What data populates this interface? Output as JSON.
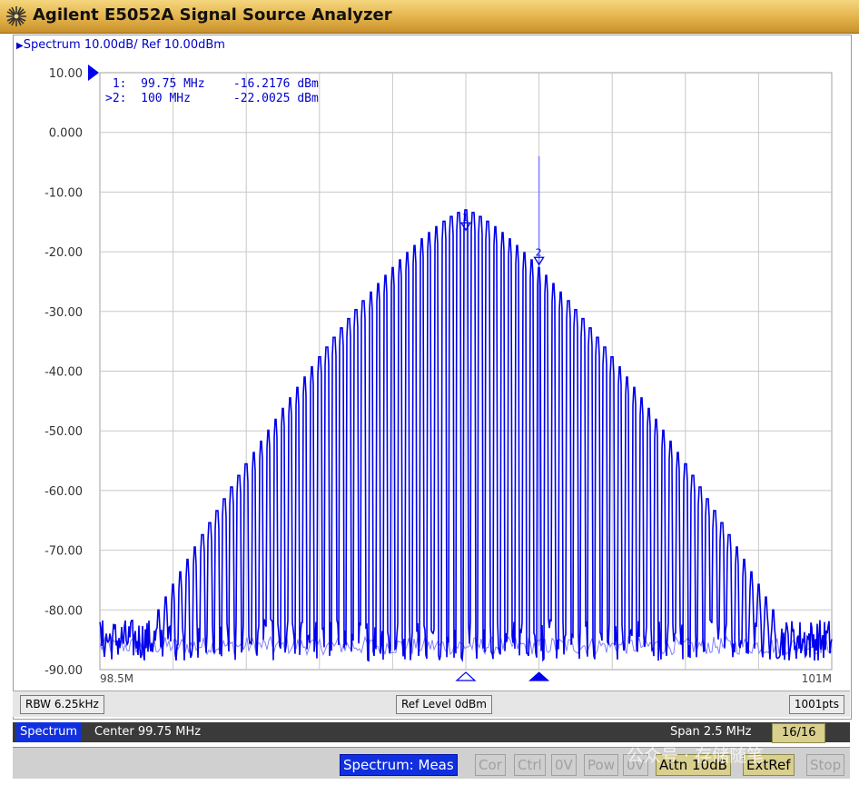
{
  "window": {
    "title": "Agilent E5052A Signal Source Analyzer",
    "logo_icon": "agilent-spark-icon"
  },
  "trace_header": {
    "arrow_icon": "trace-indicator-icon",
    "text": "Spectrum 10.00dB/ Ref 10.00dBm"
  },
  "markers": {
    "line1": " 1:  99.75 MHz    -16.2176 dBm",
    "line2": ">2:  100 MHz      -22.0025 dBm",
    "marker1_label": "1",
    "marker2_label": "2"
  },
  "x_axis": {
    "start_label": "98.5M",
    "stop_label": "101M"
  },
  "chart_data": {
    "type": "line",
    "ylim": [
      -90,
      10
    ],
    "yticks": [
      "10.00",
      "0.000",
      "-10.00",
      "-20.00",
      "-30.00",
      "-40.00",
      "-50.00",
      "-60.00",
      "-70.00",
      "-80.00",
      "-90.00"
    ],
    "xlim": [
      98.5,
      101.0
    ],
    "x_unit": "MHz",
    "grid": true,
    "spur_spacing_mhz": 0.025,
    "envelope_center_mhz": 99.75,
    "envelope_peak_dbm": -13,
    "envelope_edge_dbm": -80,
    "noise_floor_dbm": -86,
    "carrier": {
      "x": 100.0,
      "y": -4
    },
    "markers": [
      {
        "id": "1",
        "x": 99.75,
        "y": -16.2176
      },
      {
        "id": "2",
        "x": 100.0,
        "y": -22.0025
      }
    ],
    "series": [
      {
        "color": "#0000ee"
      },
      {
        "color": "#8080ff"
      }
    ]
  },
  "rbw_bar": {
    "rbw": "RBW 6.25kHz",
    "ref_level": "Ref Level 0dBm",
    "points": "1001pts"
  },
  "status_bar": {
    "mode": "Spectrum",
    "center": "Center 99.75 MHz",
    "span": "Span 2.5 MHz",
    "counter": "16/16"
  },
  "bottom_bar": {
    "meas": "Spectrum: Meas",
    "cor": "Cor",
    "ctrl": "Ctrl",
    "ov1": "0V",
    "pow": "Pow",
    "ov2": "0V",
    "attn": "Attn 10dB",
    "extref": "ExtRef",
    "stop": "Stop",
    "watermark": "公众号 · 存储随笔"
  },
  "colors": {
    "trace": "#0000ee",
    "memory_trace": "#8080ff",
    "grid": "#c8c8c8",
    "titlebar": "#e3b24a",
    "active_tag": "#1030e0"
  }
}
